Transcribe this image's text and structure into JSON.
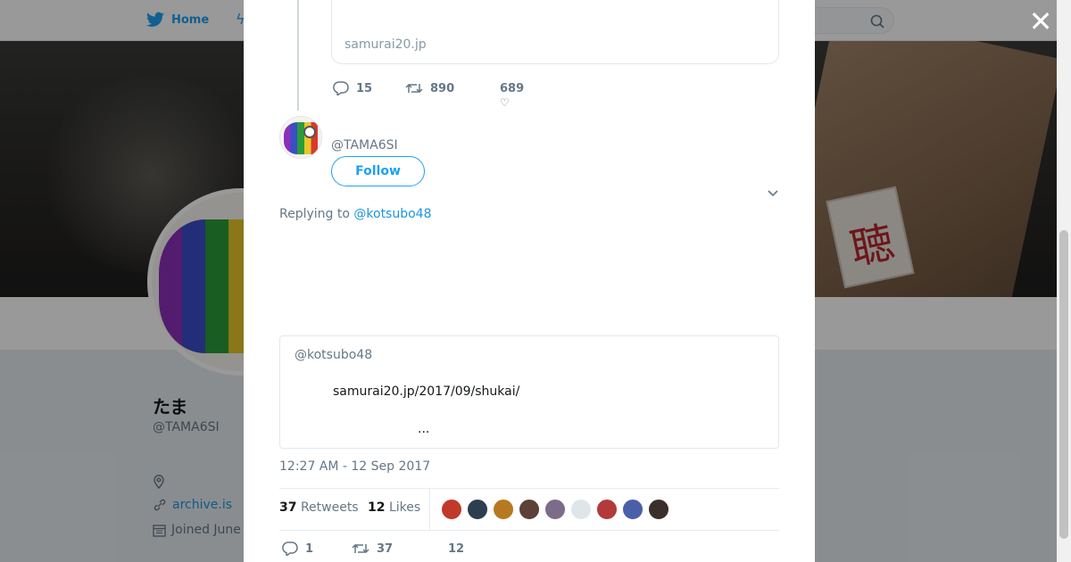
{
  "nav": {
    "home_label": "Home"
  },
  "profile": {
    "name": "たま",
    "handle": "@TAMA6SI",
    "website": "archive.is",
    "joined": "Joined June"
  },
  "prev_tweet": {
    "link_domain": "samurai20.jp",
    "replies": "15",
    "retweets": "890",
    "likes": "689"
  },
  "tweet": {
    "handle": "@TAMA6SI",
    "follow_label": "Follow",
    "replying_prefix": "Replying to",
    "replying_to": "@kotsubo48",
    "line1": "",
    "line2": "",
    "line3": "",
    "hashtag": "",
    "quote": {
      "handle": "@kotsubo48",
      "url": "samurai20.jp/2017/09/shukai/",
      "ellipsis": "..."
    },
    "timestamp": "12:27 AM - 12 Sep 2017",
    "retweets_count": "37",
    "retweets_label": "Retweets",
    "likes_count": "12",
    "likes_label": "Likes",
    "liker_avatars": [
      "#c0392b",
      "#2c3e50",
      "#b7791f",
      "#5d4037",
      "#7b6c8a",
      "#dfe6ea",
      "#b33a3a",
      "#4a5fa8",
      "#3a2f2a"
    ],
    "action_replies": "1",
    "action_retweets": "37",
    "action_likes": "12"
  },
  "colors": {
    "accent": "#1da1f2",
    "link": "#1b95e0"
  }
}
